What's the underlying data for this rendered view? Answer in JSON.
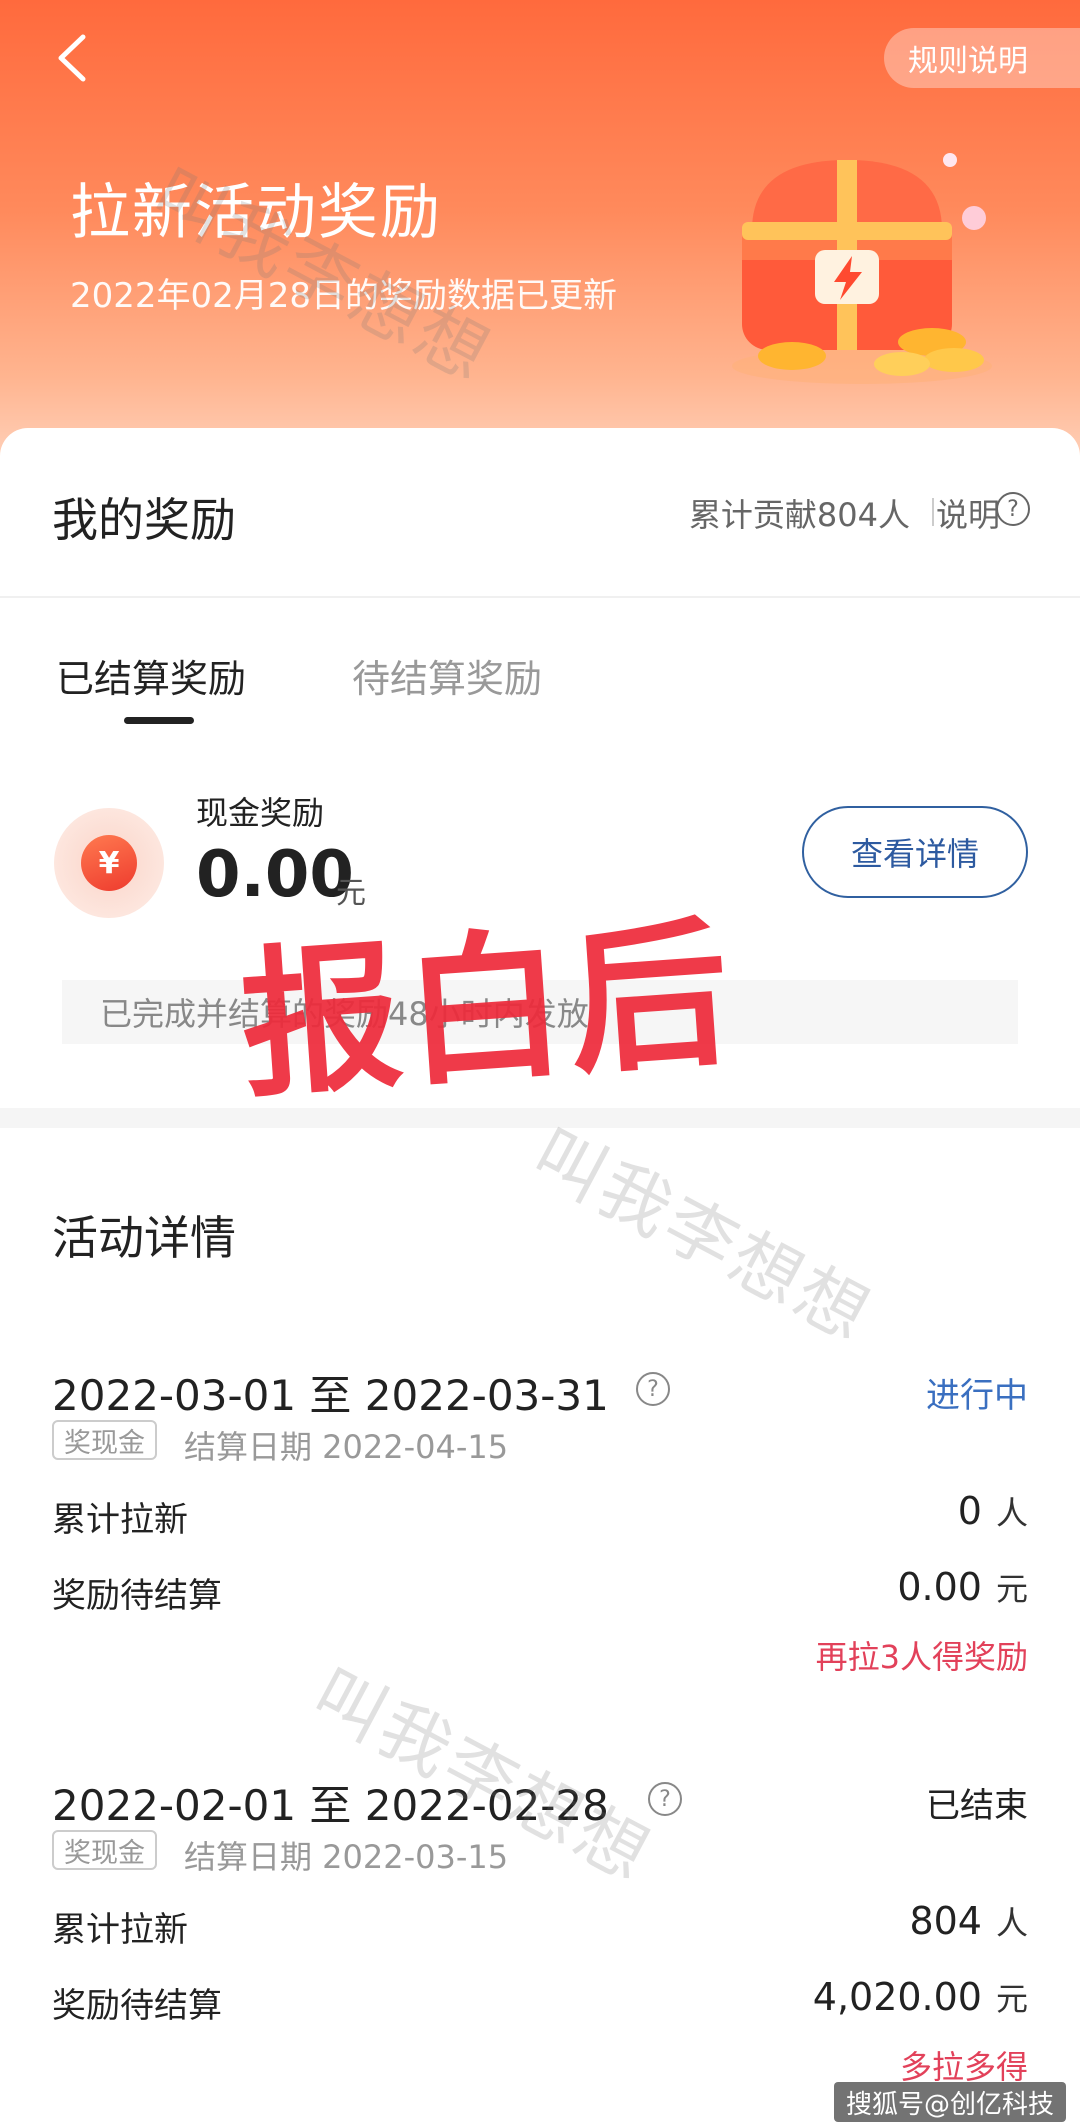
{
  "nav": {
    "rules_label": "规则说明"
  },
  "hero": {
    "title": "拉新活动奖励",
    "subtitle": "2022年02月28日的奖励数据已更新"
  },
  "reward": {
    "title": "我的奖励",
    "contrib": "累计贡献804人",
    "explain": "说明",
    "tabs": [
      {
        "label": "已结算奖励",
        "active": true
      },
      {
        "label": "待结算奖励",
        "active": false
      }
    ],
    "cash_label": "现金奖励",
    "cash_value": "0.00",
    "cash_unit": "元",
    "currency_symbol": "¥",
    "detail_button": "查看详情",
    "notice": "已完成并结算的奖励48小时内发放"
  },
  "overlay": {
    "stamp_text": "报白后",
    "watermark": "叫我李想想"
  },
  "activity": {
    "title": "活动详情",
    "periods": [
      {
        "range": "2022-03-01 至 2022-03-31",
        "status": "进行中",
        "status_color": "#3a6fc0",
        "tag": "奖现金",
        "settle": "结算日期 2022-04-15",
        "rows": [
          {
            "label": "累计拉新",
            "value": "0",
            "unit": "人"
          },
          {
            "label": "奖励待结算",
            "value": "0.00",
            "unit": "元"
          }
        ],
        "promo": "再拉3人得奖励"
      },
      {
        "range": "2022-02-01 至 2022-02-28",
        "status": "已结束",
        "status_color": "#222222",
        "tag": "奖现金",
        "settle": "结算日期 2022-03-15",
        "rows": [
          {
            "label": "累计拉新",
            "value": "804",
            "unit": "人"
          },
          {
            "label": "奖励待结算",
            "value": "4,020.00",
            "unit": "元"
          }
        ],
        "promo": "多拉多得"
      }
    ]
  },
  "footer": {
    "source_tag": "搜狐号@创亿科技"
  }
}
